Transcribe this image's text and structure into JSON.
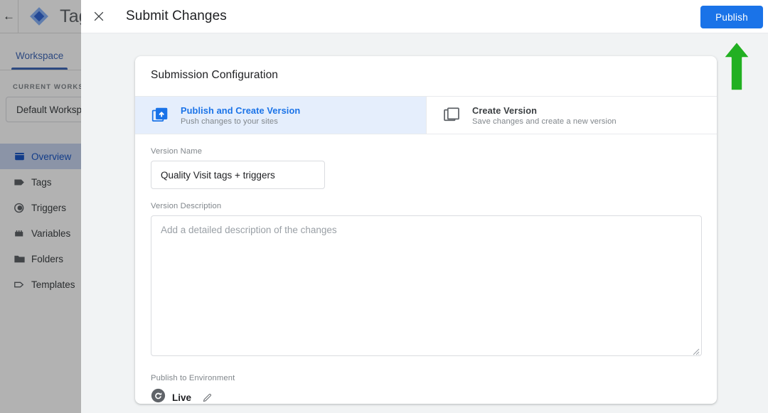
{
  "app": {
    "back_icon": "back-arrow-icon",
    "logo_icon": "google-tag-manager-logo",
    "title": "Tag",
    "tabs": [
      {
        "label": "Workspace"
      }
    ],
    "sidebar": {
      "section_heading": "CURRENT WORKSPACE",
      "workspace_chip": "Default Workspace",
      "items": [
        {
          "label": "Overview",
          "icon": "overview-icon",
          "active": true
        },
        {
          "label": "Tags",
          "icon": "tag-icon",
          "active": false
        },
        {
          "label": "Triggers",
          "icon": "trigger-icon",
          "active": false
        },
        {
          "label": "Variables",
          "icon": "variable-icon",
          "active": false
        },
        {
          "label": "Folders",
          "icon": "folder-icon",
          "active": false
        },
        {
          "label": "Templates",
          "icon": "template-icon",
          "active": false
        }
      ]
    }
  },
  "modal": {
    "close_icon": "close-icon",
    "title": "Submit Changes",
    "publish_button": "Publish",
    "card": {
      "title": "Submission Configuration",
      "options": [
        {
          "label": "Publish and Create Version",
          "sublabel": "Push changes to your sites",
          "icon": "publish-version-icon",
          "selected": true
        },
        {
          "label": "Create Version",
          "sublabel": "Save changes and create a new version",
          "icon": "create-version-icon",
          "selected": false
        }
      ],
      "version_name": {
        "label": "Version Name",
        "value": "Quality Visit tags + triggers",
        "placeholder": ""
      },
      "version_description": {
        "label": "Version Description",
        "value": "",
        "placeholder": "Add a detailed description of the changes"
      },
      "environment": {
        "label": "Publish to Environment",
        "name": "Live",
        "icon": "live-environment-icon",
        "edit_icon": "pencil-edit-icon"
      }
    }
  },
  "annotation": {
    "arrow_icon": "green-up-arrow-annotation",
    "color": "#22b022",
    "points_to": "Publish"
  },
  "colors": {
    "accent_blue": "#1a73e8",
    "selected_option_bg": "#e5eefc",
    "modal_bg": "#f1f3f4",
    "annotation_green": "#22b022"
  }
}
